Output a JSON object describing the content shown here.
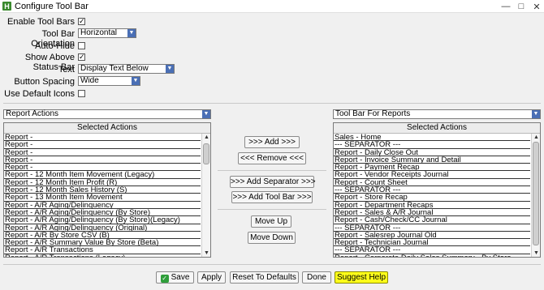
{
  "window": {
    "icon_letter": "H",
    "title": "Configure Tool Bar"
  },
  "options": {
    "enable_tool_bars_label": "Enable Tool Bars",
    "enable_tool_bars_checked": true,
    "orientation_label": "Tool Bar Orientation",
    "orientation_value": "Horizontal",
    "auto_hide_label": "Auto-Hide",
    "auto_hide_checked": false,
    "show_above_status_label": "Show Above Status Bar",
    "show_above_status_checked": true,
    "text_label": "Text",
    "text_value": "Display Text Below",
    "button_spacing_label": "Button Spacing",
    "button_spacing_value": "Wide",
    "use_default_icons_label": "Use Default Icons",
    "use_default_icons_checked": false
  },
  "left_panel": {
    "combo_value": "Report Actions",
    "header": "Selected Actions",
    "items": [
      "Report -",
      "Report -",
      "Report -",
      "Report -",
      "Report -",
      "Report - 12 Month Item Movement (Legacy)",
      "Report - 12 Month Item Profit  (R)",
      "Report - 12 Month Sales History  (S)",
      "Report - 13 Month Item Movement",
      "Report - A/R Aging/Delinquency",
      "Report - A/R Aging/Delinquency (By Store)",
      "Report - A/R Aging/Delinquency (By Store)(Legacy)",
      "Report - A/R Aging/Delinquency (Original)",
      "Report - A/R By Store CSV  (B)",
      "Report - A/R Summary Value By Store (Beta)",
      "Report - A/R Transactions",
      "Report - A/R Transactions (Legacy)"
    ]
  },
  "middle_buttons": {
    "add": ">>> Add >>>",
    "remove": "<<< Remove <<<",
    "add_separator": ">>> Add Separator >>>",
    "add_tool_bar": ">>> Add Tool Bar >>>",
    "move_up": "Move Up",
    "move_down": "Move Down"
  },
  "right_panel": {
    "combo_value": "Tool Bar For Reports",
    "header": "Selected Actions",
    "items": [
      "Sales - Home",
      "--- SEPARATOR ---",
      "Report - Daily Close Out",
      "Report - Invoice Summary and Detail",
      "Report - Payment Recap",
      "Report - Vendor Receipts Journal",
      "Report - Count Sheet",
      "--- SEPARATOR ---",
      "Report - Store Recap",
      "Report - Department Recaps",
      "Report - Sales & A/R Journal",
      "Report - Cash/Check/CC Journal",
      "--- SEPARATOR ---",
      "Report - Salesrep Journal Old",
      "Report - Technician Journal",
      "--- SEPARATOR ---",
      "Report - Corporate Daily Sales Summary - By Store"
    ]
  },
  "bottom_buttons": {
    "save": "Save",
    "apply": "Apply",
    "reset": "Reset To Defaults",
    "done": "Done",
    "suggest_help": "Suggest Help"
  },
  "colors": {
    "accent": "#4a6fb5",
    "save_icon": "#2e9e3a",
    "suggest_help_bg": "#ffff1a"
  }
}
